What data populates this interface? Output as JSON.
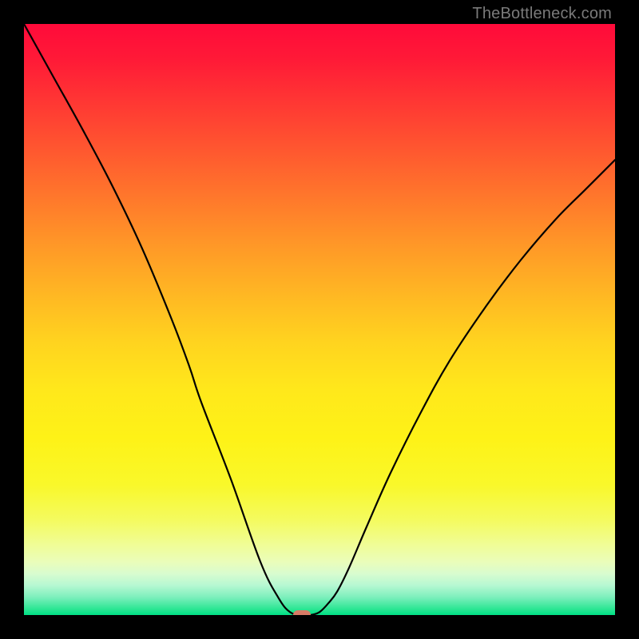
{
  "watermark": "TheBottleneck.com",
  "chart_data": {
    "type": "line",
    "title": "",
    "xlabel": "",
    "ylabel": "",
    "xlim": [
      0,
      100
    ],
    "ylim": [
      0,
      100
    ],
    "grid": false,
    "series": [
      {
        "name": "curve",
        "x": [
          0,
          5,
          10,
          15,
          20,
          25,
          28,
          30,
          35,
          40,
          43,
          45,
          47,
          48.5,
          50,
          51.5,
          53,
          55,
          58,
          62,
          67,
          72,
          78,
          84,
          90,
          95,
          100
        ],
        "y": [
          100,
          91,
          82,
          72.5,
          62,
          50,
          42,
          36,
          23,
          9,
          3,
          0.5,
          0,
          0,
          0.5,
          2,
          4,
          8,
          15,
          24,
          34,
          43,
          52,
          60,
          67,
          72,
          77
        ]
      }
    ],
    "marker": {
      "x": 47,
      "y": 0
    },
    "background_gradient": {
      "type": "vertical",
      "stops": [
        {
          "pos": 0.0,
          "color": "#ff0a3a"
        },
        {
          "pos": 0.5,
          "color": "#ffd41f"
        },
        {
          "pos": 0.85,
          "color": "#f4fb60"
        },
        {
          "pos": 1.0,
          "color": "#00e085"
        }
      ]
    }
  }
}
